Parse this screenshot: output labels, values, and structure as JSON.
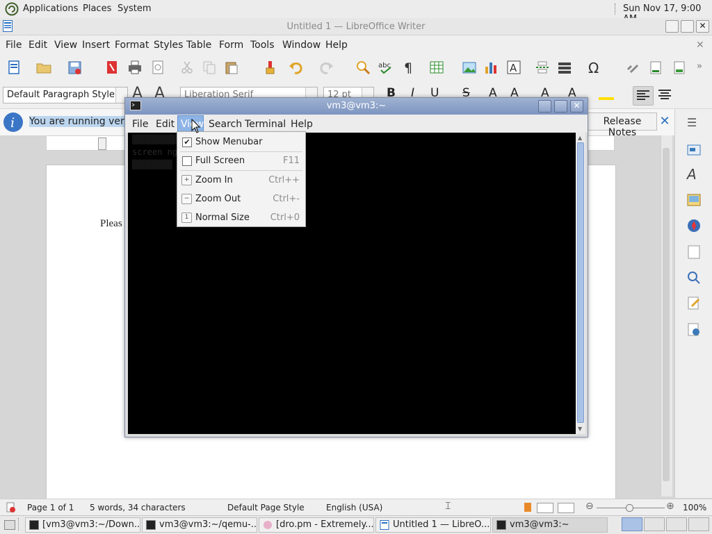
{
  "top_panel": {
    "applications": "Applications",
    "places": "Places",
    "system": "System",
    "clock": "Sun Nov 17,  9:00 AM"
  },
  "writer": {
    "title": "Untitled 1 — LibreOffice Writer",
    "menu": [
      "File",
      "Edit",
      "View",
      "Insert",
      "Format",
      "Styles",
      "Table",
      "Form",
      "Tools",
      "Window",
      "Help"
    ],
    "paragraph_style": "Default Paragraph Style",
    "font_name": "Liberation Serif",
    "font_size": "12 pt",
    "infobar_text": "You are running version",
    "release_notes": "Release Notes",
    "doc_text": "Pleas"
  },
  "status": {
    "page": "Page 1 of 1",
    "words": "5 words, 34 characters",
    "page_style": "Default Page Style",
    "language": "English (USA)",
    "zoom": "100%"
  },
  "terminal": {
    "title": "vm3@vm3:~",
    "menu": [
      "File",
      "Edit",
      "View",
      "Search",
      "Terminal",
      "Help"
    ],
    "line2": "screen  ng                  ce -h for help)"
  },
  "view_menu": {
    "items": [
      {
        "label": "Show Menubar",
        "shortcut": "",
        "checked": true
      },
      {
        "label": "Full Screen",
        "shortcut": "F11",
        "checked": false
      },
      {
        "label": "Zoom In",
        "shortcut": "Ctrl++"
      },
      {
        "label": "Zoom Out",
        "shortcut": "Ctrl+-"
      },
      {
        "label": "Normal Size",
        "shortcut": "Ctrl+0"
      }
    ]
  },
  "taskbar": [
    "[vm3@vm3:~/Down...",
    "vm3@vm3:~/qemu-...",
    "[dro.pm - Extremely...",
    "Untitled 1 — LibreO...",
    "vm3@vm3:~"
  ]
}
